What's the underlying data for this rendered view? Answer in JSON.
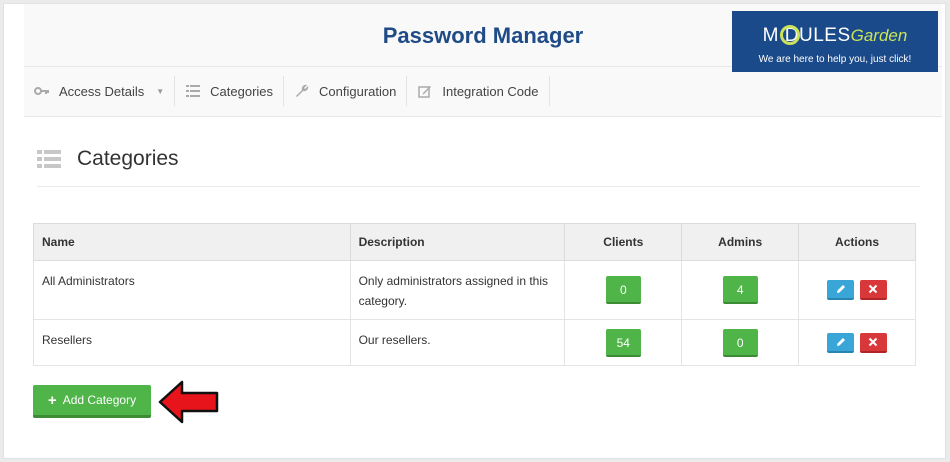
{
  "app": {
    "title": "Password Manager"
  },
  "logo": {
    "brand_bold": "M  DULES",
    "brand_light": "Garden",
    "tagline": "We are here to help you, just click!"
  },
  "nav": [
    {
      "label": "Access Details",
      "icon": "key-icon",
      "has_dropdown": true
    },
    {
      "label": "Categories",
      "icon": "list-icon"
    },
    {
      "label": "Configuration",
      "icon": "wrench-icon"
    },
    {
      "label": "Integration Code",
      "icon": "edit-icon"
    }
  ],
  "section": {
    "title": "Categories",
    "icon": "list-icon"
  },
  "table": {
    "headers": [
      "Name",
      "Description",
      "Clients",
      "Admins",
      "Actions"
    ],
    "rows": [
      {
        "name": "All Administrators",
        "description": "Only administrators assigned in this category.",
        "clients": "0",
        "admins": "4"
      },
      {
        "name": "Resellers",
        "description": "Our resellers.",
        "clients": "54",
        "admins": "0"
      }
    ]
  },
  "actions": {
    "add_label": "Add Category"
  },
  "colors": {
    "primary_blue": "#1f4b86",
    "success_green": "#4fb548",
    "info_blue": "#3aa6d8",
    "danger_red": "#d9383a",
    "arrow_red": "#e8141c"
  }
}
